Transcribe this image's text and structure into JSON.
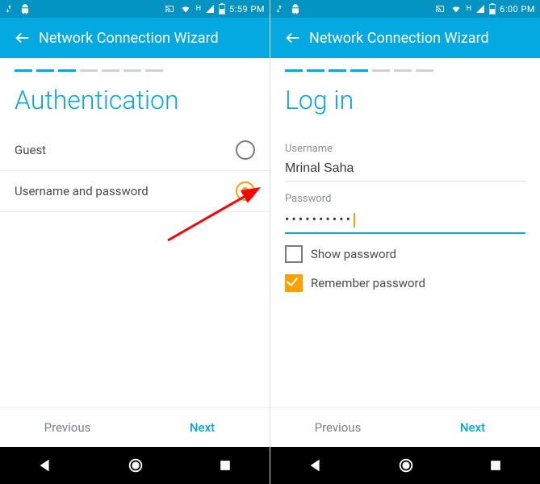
{
  "left": {
    "statusbar": {
      "time": "5:59 PM",
      "net_label": "H"
    },
    "appbar": {
      "title": "Network Connection Wizard"
    },
    "progress": {
      "step": 3,
      "total": 7
    },
    "heading": "Authentication",
    "options": {
      "guest": {
        "label": "Guest",
        "selected": false
      },
      "userpass": {
        "label": "Username and password",
        "selected": true
      }
    },
    "footer": {
      "prev": "Previous",
      "next": "Next"
    }
  },
  "right": {
    "statusbar": {
      "time": "6:00 PM",
      "net_label": "H"
    },
    "appbar": {
      "title": "Network Connection Wizard"
    },
    "progress": {
      "step": 4,
      "total": 7
    },
    "heading": "Log in",
    "form": {
      "username_label": "Username",
      "username_value": "Mrinal Saha",
      "password_label": "Password",
      "password_value": "••••••••••",
      "show_pw_label": "Show password",
      "show_pw_checked": false,
      "remember_label": "Remember password",
      "remember_checked": true
    },
    "footer": {
      "prev": "Previous",
      "next": "Next"
    }
  },
  "colors": {
    "brand": "#03a9e0",
    "statusbar": "#0394c4",
    "accent": "#ffa000",
    "arrow": "#ff0000"
  }
}
